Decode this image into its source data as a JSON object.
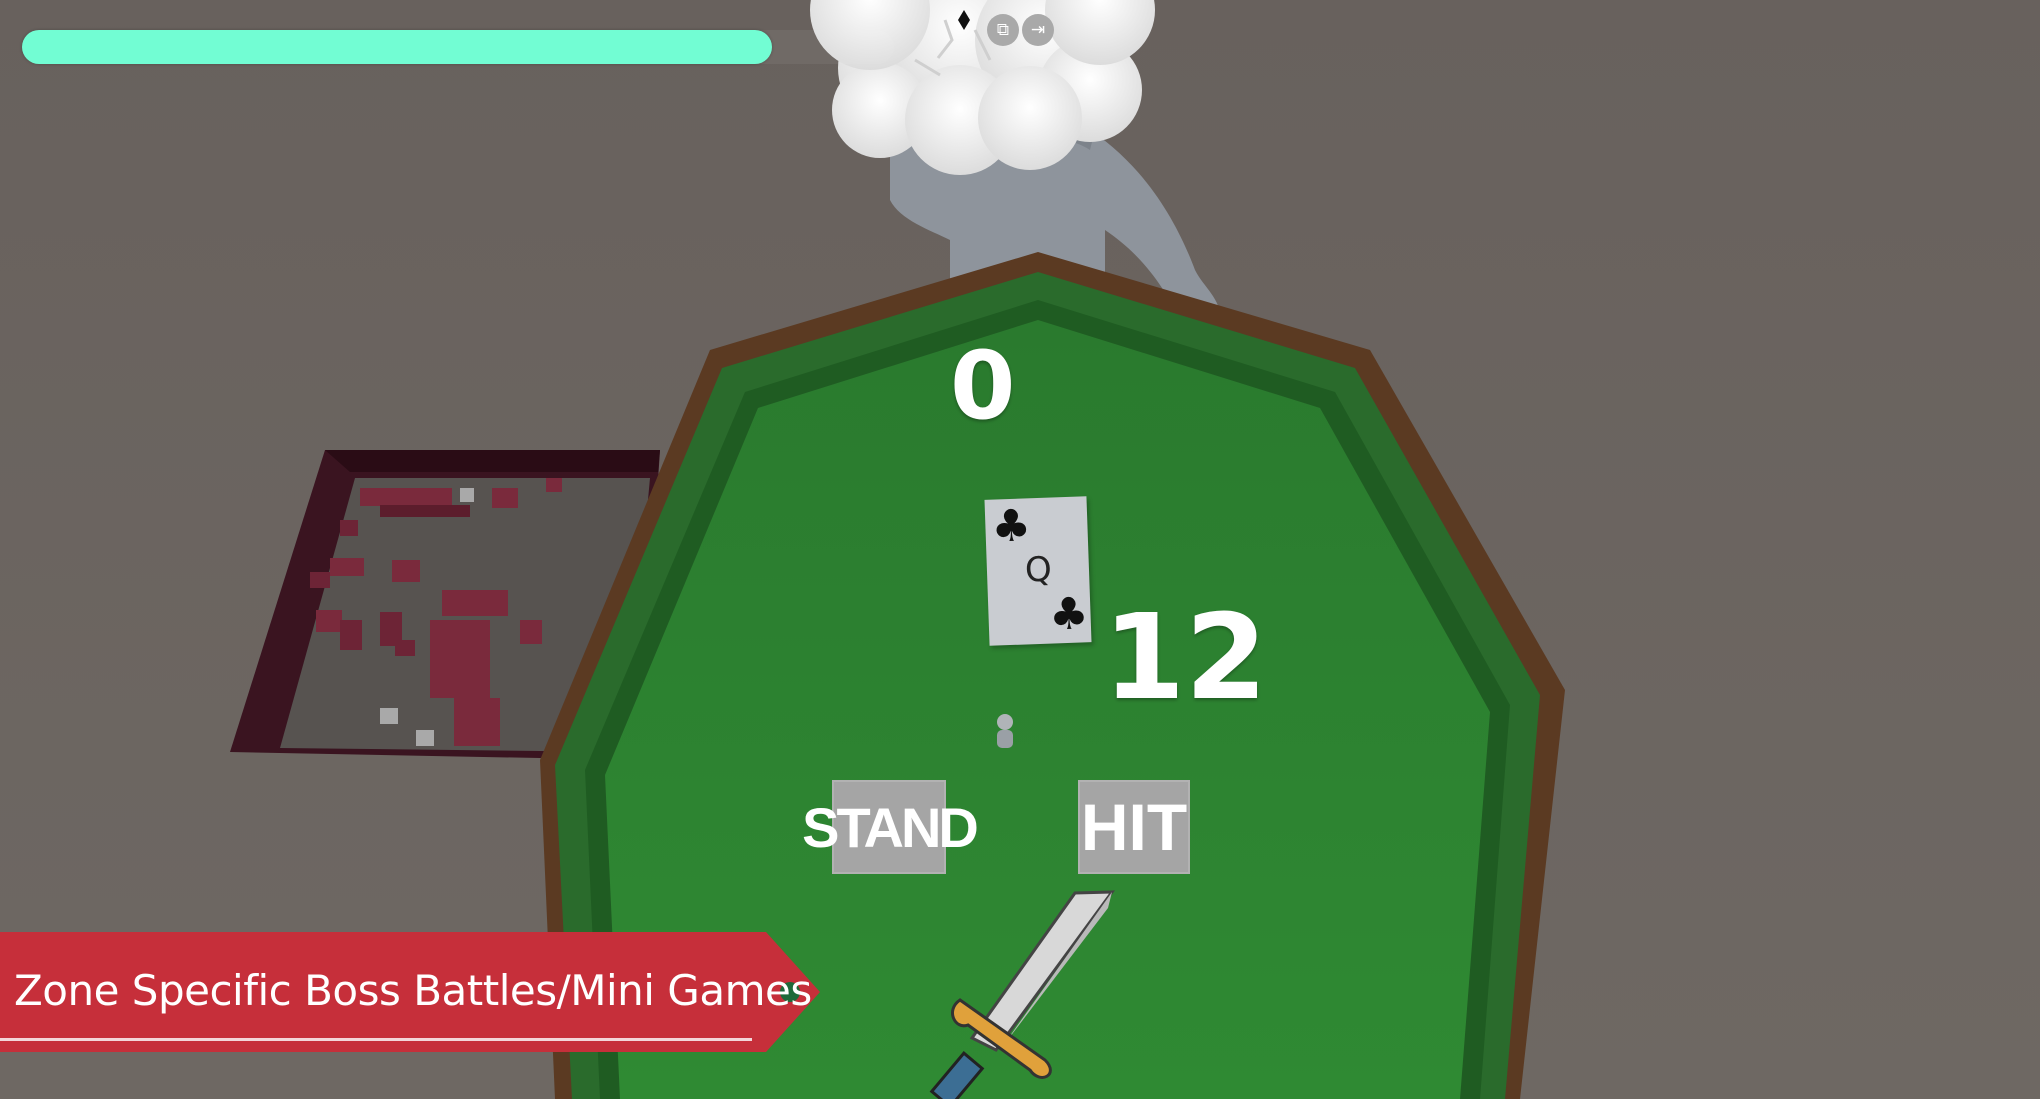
{
  "hud": {
    "health_fraction": 0.86,
    "health_color": "#72fdd3",
    "icons": [
      "restore-window-icon",
      "exit-icon"
    ]
  },
  "table": {
    "dealer_score": "0",
    "player_score": "12",
    "felt_color": "#2e7d32",
    "rim_color": "#5a3a22"
  },
  "card": {
    "rank": "Q",
    "suit": "♣"
  },
  "buttons": {
    "stand_label": "STAND",
    "hit_label": "HIT"
  },
  "caption": {
    "text": "Zone Specific Boss Battles/Mini Games",
    "color": "#c62f3a"
  }
}
